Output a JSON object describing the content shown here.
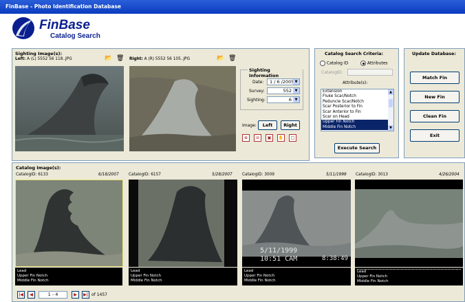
{
  "window": {
    "title": "FinBase - Photo Identification Database"
  },
  "logo": {
    "title": "FinBase",
    "subtitle": "Catalog Search"
  },
  "sighting": {
    "header": "Sighting Image(s):",
    "left_label": "Left:",
    "left_file": "A (L) 5552 56 118..JPG",
    "right_label": "Right:",
    "right_file": "A (R) 5552 56 105..JPG"
  },
  "sighting_info": {
    "title": "Sighting Information",
    "date_label": "Date:",
    "date_value": "1 / 6 /2005",
    "survey_label": "Survey:",
    "survey_value": "552",
    "sighting_label": "Sighting:",
    "sighting_value": "6",
    "image_label": "Image:",
    "left_btn": "Left",
    "right_btn": "Right"
  },
  "search": {
    "title": "Catalog Search Criteria:",
    "radio_catalog": "Catalog ID",
    "radio_attributes": "Attributes",
    "catalogid_label": "CatalogID:",
    "attributes_label": "Attribute(s):",
    "attributes": [
      "Extension",
      "Fluke Scar/Notch",
      "Peduncle Scar/Notch",
      "Scar Posterior to Fin",
      "Scar Anterior to Fin",
      "Scar on Head",
      "Upper Fin Notch",
      "Middle Fin Notch"
    ],
    "execute_btn": "Execute Search"
  },
  "update": {
    "title": "Update Database:",
    "match_btn": "Match Fin",
    "new_btn": "New Fin",
    "clean_btn": "Clean Fin",
    "exit_btn": "Exit"
  },
  "catalog": {
    "header": "Catalog Image(s):",
    "items": [
      {
        "id": "CatalogID: 6133",
        "date": "6/18/2007",
        "tags": [
          "Lead",
          "Upper Fin Notch",
          "Middle Fin Notch"
        ]
      },
      {
        "id": "CatalogID: 6157",
        "date": "5/28/2007",
        "tags": [
          "Lead",
          "Upper Fin Notch",
          "Middle Fin Notch"
        ]
      },
      {
        "id": "CatalogID: 3009",
        "date": "5/11/1999",
        "tags": [
          "Lead",
          "Upper Fin Notch",
          "Middle Fin Notch"
        ],
        "stamp_date": "5/11/1999",
        "stamp_time": "10:51 CAM",
        "stamp_clock": "8:38:49"
      },
      {
        "id": "CatalogID: 3013",
        "date": "4/26/2004",
        "tags": [
          "Lead",
          "Upper Fin Notch",
          "Middle Fin Notch"
        ]
      }
    ],
    "page_range": "1 - 4",
    "page_total": "of 1457"
  }
}
